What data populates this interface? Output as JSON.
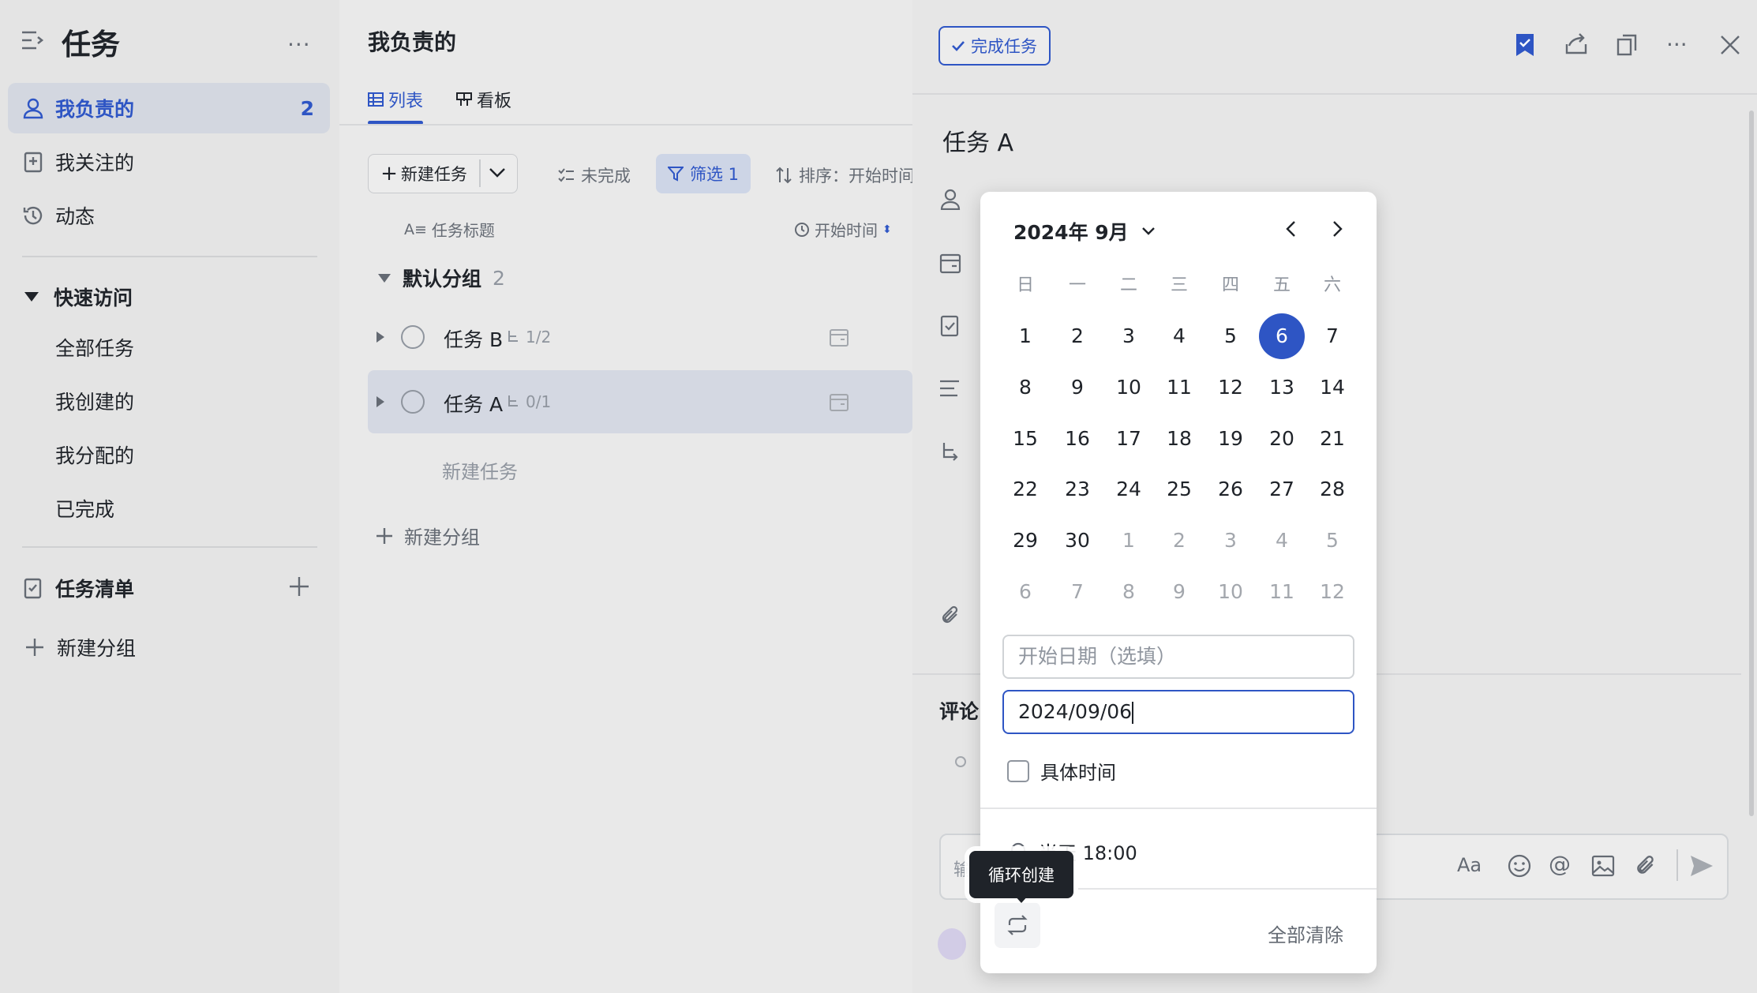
{
  "sidebar": {
    "title": "任务",
    "items": [
      {
        "label": "我负责的",
        "count": "2"
      },
      {
        "label": "我关注的"
      },
      {
        "label": "动态"
      }
    ],
    "quick_access": {
      "label": "快速访问",
      "items": [
        "全部任务",
        "我创建的",
        "我分配的",
        "已完成"
      ]
    },
    "task_lists": {
      "label": "任务清单"
    },
    "new_group": "新建分组"
  },
  "main": {
    "title": "我负责的",
    "tabs": [
      {
        "label": "列表"
      },
      {
        "label": "看板"
      }
    ],
    "toolbar": {
      "new_task": "新建任务",
      "incomplete": "未完成",
      "filter": "筛选 1",
      "sort": "排序：开始时间"
    },
    "columns": {
      "title": "任务标题",
      "start_time": "开始时间"
    },
    "group": {
      "name": "默认分组",
      "count": "2"
    },
    "tasks": [
      {
        "name": "任务 B",
        "subtasks": "1/2"
      },
      {
        "name": "任务 A",
        "subtasks": "0/1"
      }
    ],
    "new_task_row": "新建任务",
    "new_group": "新建分组"
  },
  "detail": {
    "complete_button": "完成任务",
    "task_title": "任务 A",
    "comments_label": "评论",
    "comment_placeholder": "输"
  },
  "calendar": {
    "month_label": "2024年 9月",
    "weekdays": [
      "日",
      "一",
      "二",
      "三",
      "四",
      "五",
      "六"
    ],
    "weeks": [
      [
        "1",
        "2",
        "3",
        "4",
        "5",
        "6",
        "7"
      ],
      [
        "8",
        "9",
        "10",
        "11",
        "12",
        "13",
        "14"
      ],
      [
        "15",
        "16",
        "17",
        "18",
        "19",
        "20",
        "21"
      ],
      [
        "22",
        "23",
        "24",
        "25",
        "26",
        "27",
        "28"
      ],
      [
        "29",
        "30",
        "1",
        "2",
        "3",
        "4",
        "5"
      ],
      [
        "6",
        "7",
        "8",
        "9",
        "10",
        "11",
        "12"
      ]
    ],
    "selected_day": "6",
    "start_date_placeholder": "开始日期（选填）",
    "due_date_value": "2024/09/06",
    "specific_time_label": "具体时间",
    "reminder": "当天 18:00",
    "recurring_tooltip": "循环创建",
    "clear_all": "全部清除"
  },
  "colors": {
    "accent": "#2e55c4",
    "selected_bg": "#d3d7e0"
  }
}
